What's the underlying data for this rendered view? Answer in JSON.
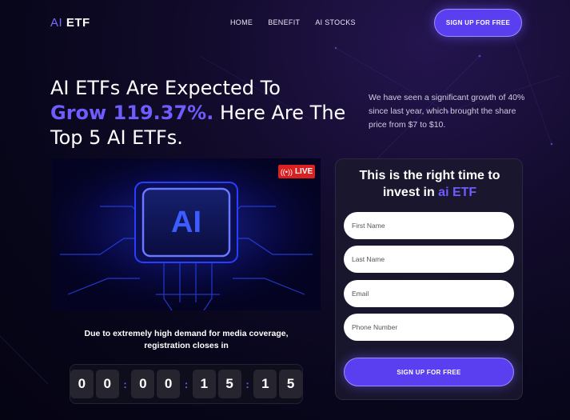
{
  "header": {
    "logo_ai": "AI",
    "logo_etf": "ETF",
    "nav": [
      "HOME",
      "BENEFIT",
      "AI STOCKS"
    ],
    "cta": "SIGN UP FOR FREE"
  },
  "hero": {
    "title_line1": "AI ETFs Are Expected To",
    "title_highlight": "Grow 119.37%.",
    "title_rest_a": " Here Are The",
    "title_line3": "Top 5 AI ETFs.",
    "description": "We have seen a significant growth of 40% since last year, which brought the share price from $7 to $10."
  },
  "video": {
    "live_label": "LIVE",
    "chip_text": "AI"
  },
  "notice": {
    "line1": "Due to extremely high demand for media coverage,",
    "line2": "registration closes in"
  },
  "countdown": {
    "digits": [
      "0",
      "0",
      "0",
      "0",
      "1",
      "5",
      "1",
      "5"
    ],
    "separator": ":"
  },
  "form": {
    "title_a": "This is the right time to",
    "title_b": "invest in ",
    "title_highlight": "ai ETF",
    "fields": {
      "first_name": "First Name",
      "last_name": "Last Name",
      "email": "Email",
      "phone": "Phone Number"
    },
    "submit": "SIGN UP FOR FREE"
  },
  "colors": {
    "accent": "#6f5cff",
    "button": "#5a3ff0",
    "live": "#d92121",
    "background": "#07061a"
  }
}
